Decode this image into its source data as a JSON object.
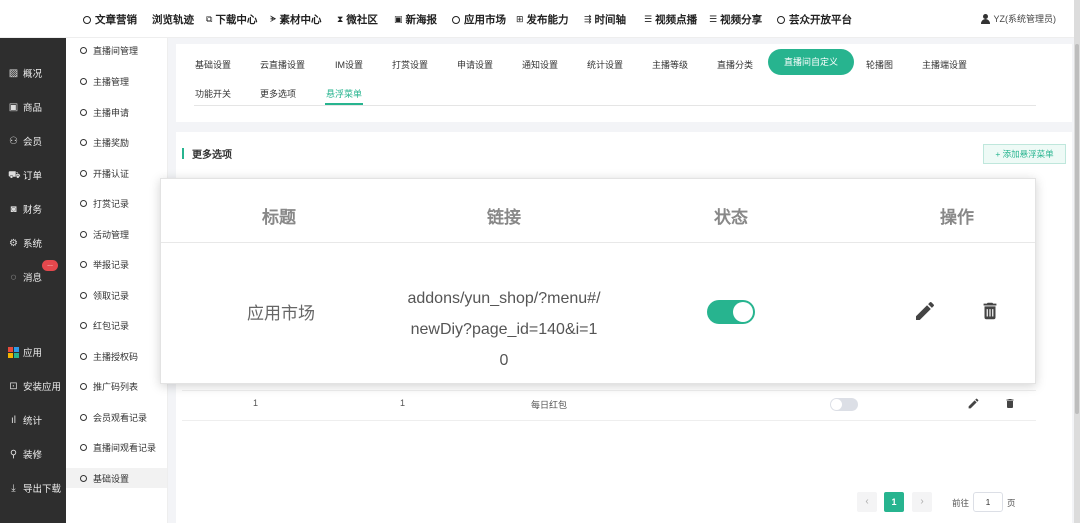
{
  "topnav": [
    {
      "label": "文章营销",
      "icon": "ring-icon"
    },
    {
      "label": "浏览轨迹",
      "icon": ""
    },
    {
      "label": "下载中心",
      "icon": "download-icon"
    },
    {
      "label": "素材中心",
      "icon": "material-icon"
    },
    {
      "label": "微社区",
      "icon": "hourglass-icon"
    },
    {
      "label": "新海报",
      "icon": "image-icon"
    },
    {
      "label": "应用市场",
      "icon": "ring-icon"
    },
    {
      "label": "发布能力",
      "icon": "plus-square-icon"
    },
    {
      "label": "时间轴",
      "icon": "timeline-icon"
    },
    {
      "label": "视频点播",
      "icon": "list-icon"
    },
    {
      "label": "视频分享",
      "icon": "list-icon"
    },
    {
      "label": "芸众开放平台",
      "icon": "ring-icon"
    }
  ],
  "user": {
    "label": "YZ(系统管理员)"
  },
  "sidebar": [
    {
      "label": "概况",
      "icon": "chart-icon"
    },
    {
      "label": "商品",
      "icon": "goods-icon"
    },
    {
      "label": "会员",
      "icon": "users-icon"
    },
    {
      "label": "订单",
      "icon": "cart-icon"
    },
    {
      "label": "财务",
      "icon": "finance-icon"
    },
    {
      "label": "系统",
      "icon": "gear-icon"
    },
    {
      "label": "消息",
      "icon": "message-icon"
    },
    {
      "label": "应用",
      "icon": "apps-icon"
    },
    {
      "label": "安装应用",
      "icon": "install-icon"
    },
    {
      "label": "统计",
      "icon": "bar-chart-icon"
    },
    {
      "label": "装修",
      "icon": "decorate-icon"
    },
    {
      "label": "导出下载",
      "icon": "export-icon"
    }
  ],
  "sidebar_badge": "...",
  "subsidebar": [
    "直播间管理",
    "主播管理",
    "主播申请",
    "主播奖励",
    "开播认证",
    "打赏记录",
    "活动管理",
    "举报记录",
    "领取记录",
    "红包记录",
    "主播授权码",
    "推广码列表",
    "会员观看记录",
    "直播间观看记录",
    "基础设置"
  ],
  "tabs": [
    "基础设置",
    "云直播设置",
    "IM设置",
    "打赏设置",
    "申请设置",
    "通知设置",
    "统计设置",
    "主播等级",
    "直播分类",
    "直播间自定义",
    "轮播图",
    "主播端设置"
  ],
  "subtabs": [
    "功能开关",
    "更多选项",
    "悬浮菜单"
  ],
  "section": {
    "title": "更多选项",
    "add_button": "+ 添加悬浮菜单"
  },
  "table": {
    "headers": [
      "标题",
      "链接",
      "状态",
      "操作"
    ],
    "zoom_row": {
      "title": "应用市场",
      "link": "addons/yun_shop/?menu#/newDiy?page_id=140&i=10",
      "link_lines": [
        "addons/yun_shop/?menu#/",
        "newDiy?page_id=140&i=1",
        "0"
      ],
      "status": "on"
    },
    "bg_row": {
      "col1": "1",
      "col2": "1",
      "col3": "每日红包",
      "status": "off"
    }
  },
  "pagination": {
    "prev": "‹",
    "current": "1",
    "next": "›",
    "goto_label": "前往",
    "goto_value": "1",
    "page_suffix": "页"
  },
  "colors": {
    "accent": "#27b48f",
    "sidebar": "#2e2e2e",
    "badge": "#e5484d"
  }
}
